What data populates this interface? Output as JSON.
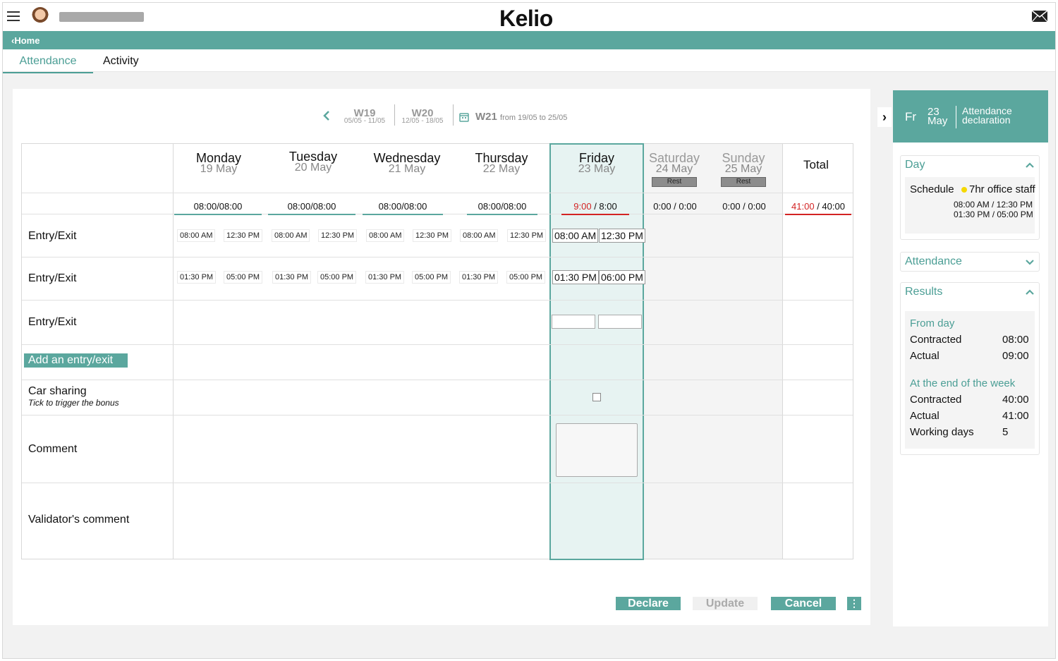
{
  "app": {
    "brand": "Kelio",
    "home_label": "Home"
  },
  "tabs": [
    {
      "label": "Attendance"
    },
    {
      "label": "Activity"
    }
  ],
  "weeknav": {
    "w19": {
      "label": "W19",
      "range": "05/05 - 11/05"
    },
    "w20": {
      "label": "W20",
      "range": "12/05 - 18/05"
    },
    "current": {
      "label": "W21",
      "range": "from 19/05 to 25/05"
    }
  },
  "days": [
    {
      "name": "Monday",
      "date": "19 May",
      "schedule": "08:00/08:00",
      "in1": "08:00 AM",
      "out1": "12:30 PM",
      "in2": "01:30 PM",
      "out2": "05:00 PM"
    },
    {
      "name": "Tuesday",
      "date": "20 May",
      "schedule": "08:00/08:00",
      "in1": "08:00 AM",
      "out1": "12:30 PM",
      "in2": "01:30 PM",
      "out2": "05:00 PM"
    },
    {
      "name": "Wednesday",
      "date": "21 May",
      "schedule": "08:00/08:00",
      "in1": "08:00 AM",
      "out1": "12:30 PM",
      "in2": "01:30 PM",
      "out2": "05:00 PM"
    },
    {
      "name": "Thursday",
      "date": "22 May",
      "schedule": "08:00/08:00",
      "in1": "08:00 AM",
      "out1": "12:30 PM",
      "in2": "01:30 PM",
      "out2": "05:00 PM"
    },
    {
      "name": "Friday",
      "date": "23 May",
      "schedule_actual": "9:00",
      "schedule_contracted": " / 8:00",
      "in1": "08:00 AM",
      "out1": "12:30 PM",
      "in2": "01:30 PM",
      "out2": "06:00 PM"
    },
    {
      "name": "Saturday",
      "date": "24 May",
      "badge": "Rest",
      "schedule": "0:00 / 0:00"
    },
    {
      "name": "Sunday",
      "date": "25 May",
      "badge": "Rest",
      "schedule": "0:00 / 0:00"
    }
  ],
  "total": {
    "label": "Total",
    "actual": "41:00",
    "contracted": " / 40:00"
  },
  "rows": {
    "entry_exit": "Entry/Exit",
    "add_entry": "Add an entry/exit",
    "car_sharing": "Car sharing",
    "car_sharing_hint": "Tick to trigger the bonus",
    "comment": "Comment",
    "validator_comment": "Validator's comment"
  },
  "actions": {
    "declare": "Declare",
    "update": "Update",
    "cancel": "Cancel",
    "more": "⋮"
  },
  "side": {
    "weekday": "Fr",
    "day": "23",
    "month": "May",
    "title_line1": "Attendance",
    "title_line2": "declaration",
    "day_panel": {
      "title": "Day",
      "schedule_label": "Schedule",
      "schedule_name": "7hr office staff",
      "slot1": "08:00 AM / 12:30 PM",
      "slot2": "01:30 PM / 05:00 PM"
    },
    "attendance_panel": {
      "title": "Attendance"
    },
    "results_panel": {
      "title": "Results",
      "from_day": "From day",
      "contracted_label": "Contracted",
      "contracted_day": "08:00",
      "actual_label": "Actual",
      "actual_day": "09:00",
      "end_of_week": "At the end of the week",
      "contracted_week": "40:00",
      "actual_week": "41:00",
      "working_days_label": "Working days",
      "working_days": "5"
    }
  },
  "colors": {
    "accent": "#5ba79e",
    "alert": "#d32323",
    "schedule_dot": "#f5d800"
  }
}
